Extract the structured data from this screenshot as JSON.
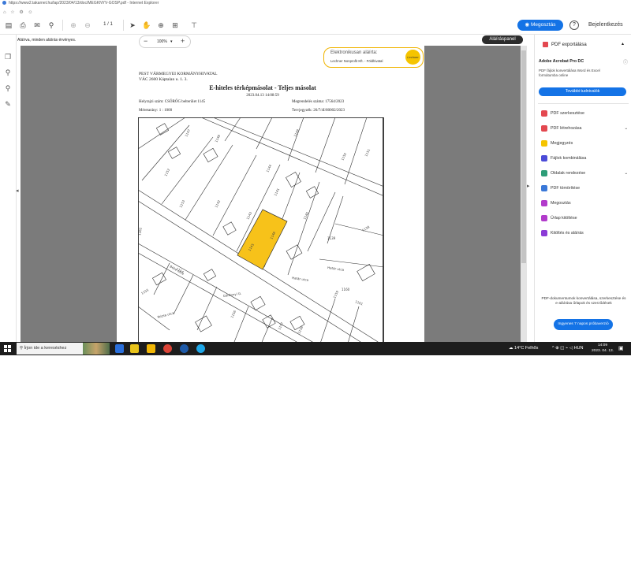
{
  "browser": {
    "title": "https://www2.takarnet.hu/lap/2023/04/13/doc/MEGKNYV-GOSP.pdf - Internet Explorer",
    "favorites": [
      "⌂",
      "☆",
      "⚙",
      "☺"
    ]
  },
  "toolbar": {
    "page_current": "1",
    "page_total": "/ 1",
    "share_label": "Megosztás",
    "help_label": "?",
    "signin_label": "Bejelentkezés"
  },
  "signature_bar": {
    "message": "Aláírva, minden aláírás érvényes.",
    "panel_button": "Aláíráspanel"
  },
  "zoom": {
    "minus": "−",
    "value": "100%",
    "caret": "▾",
    "plus": "+"
  },
  "document": {
    "stamp_title": "Elektronikusan aláírta:",
    "stamp_signer": "Lechner Nonprofit Kft. - Földhivatal",
    "stamp_seal": "Lechner",
    "office": "PEST VÁRMEGYEI KORMÁNYHIVATAL",
    "address": "VÁC 2600 Káptalan u. 1. 3.",
    "heading": "E-hiteles térképmásolat - Teljes másolat",
    "datetime": "2023.04.13 14:08:59",
    "place_label": "Helyrajzi szám:",
    "place_value": "CSÖRÖG belterület 1145",
    "order_label": "Megrendelés száma:",
    "order_value": "17564/2023",
    "scale_label": "Méretarány:",
    "scale_value": "1 : 1000",
    "plan_label": "Tervjegyzék:",
    "plan_value": "26/7/4I/80002/2023",
    "map_labels": {
      "parcel": "1145",
      "street1": "Határ utca",
      "street2": "Határ utca",
      "street3": "Gárdonyi G.",
      "street4": "Rózsa utca",
      "street5": "Béke utca",
      "lots": [
        "1147",
        "1148",
        "1149",
        "1150",
        "1151",
        "1152",
        "1153",
        "1144",
        "1143",
        "1142",
        "1141",
        "1140",
        "1139",
        "1138",
        "1146",
        "1154",
        "1155",
        "1156",
        "1157",
        "1158",
        "1159",
        "1160",
        "1161",
        "1162",
        "1116",
        "1117",
        "1118",
        "1119",
        "1120",
        "1121",
        "1122",
        "1123",
        "1124"
      ]
    }
  },
  "right_panel": {
    "export_title": "PDF exportálása",
    "product": "Adobe Acrobat Pro DC",
    "product_desc": "PDF fájlok konvertálása Word és Excel formátumba online",
    "learn_more": "További tudnivalók",
    "tools": [
      {
        "label": "PDF szerkesztése",
        "color": "#e34850"
      },
      {
        "label": "PDF létrehozása",
        "color": "#e34850"
      },
      {
        "label": "Megjegyzés",
        "color": "#f5c400"
      },
      {
        "label": "Fájlok kombinálása",
        "color": "#4b4bd8"
      },
      {
        "label": "Oldalak rendezése",
        "color": "#2d9d78"
      },
      {
        "label": "PDF tömörítése",
        "color": "#3a78d8"
      },
      {
        "label": "Megosztás",
        "color": "#b23bcb"
      },
      {
        "label": "Űrlap kitöltése",
        "color": "#b23bcb"
      },
      {
        "label": "Kitöltés és aláírás",
        "color": "#8b3bd6"
      }
    ],
    "promo_text": "PDF-dokumentumok konvertálása, szerkesztése és e-aláírása űrlapok és szerződések",
    "trial_button": "Ingyenes 7 napos próbaverzió"
  },
  "taskbar": {
    "search_placeholder": "Írjon ide a kereséshez",
    "weather": "14°C  Felhős",
    "language": "HUN",
    "time": "14:09",
    "date": "2023. 04. 13."
  }
}
